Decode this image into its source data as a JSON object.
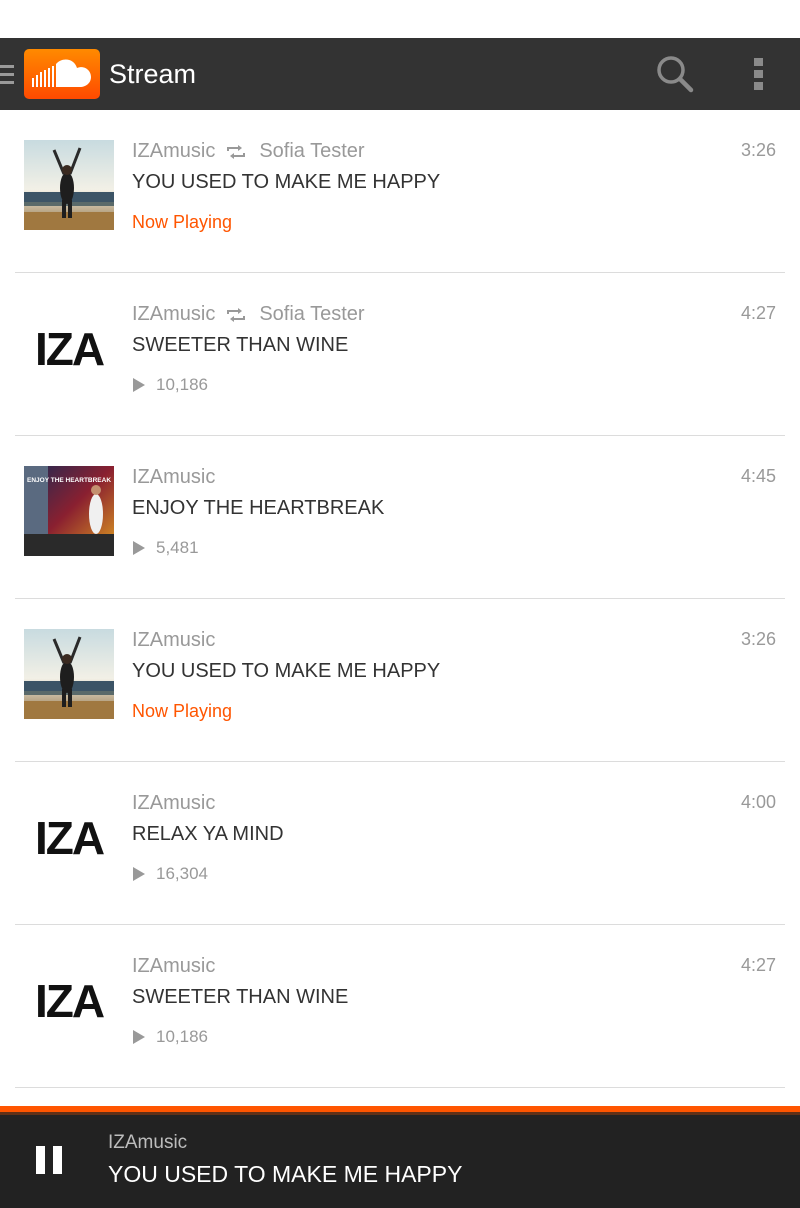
{
  "header": {
    "title": "Stream",
    "logo_icon": "soundcloud-logo",
    "search_icon": "search-icon",
    "menu_icon": "overflow-menu-icon",
    "accent_color": "#ff5500",
    "bar_color": "#333333"
  },
  "tracks": [
    {
      "artist": "IZAmusic",
      "reposted_by": "Sofia Tester",
      "title": "YOU USED TO MAKE ME HAPPY",
      "duration": "3:26",
      "status": "Now Playing",
      "plays": "",
      "artwork": "photo-arms-raised"
    },
    {
      "artist": "IZAmusic",
      "reposted_by": "Sofia Tester",
      "title": "SWEETER THAN WINE",
      "duration": "4:27",
      "status": "",
      "plays": "10,186",
      "artwork": "iza-logo"
    },
    {
      "artist": "IZAmusic",
      "reposted_by": "",
      "title": "ENJOY THE HEARTBREAK",
      "duration": "4:45",
      "status": "",
      "plays": "5,481",
      "artwork": "enjoy-the-heartbreak-cover"
    },
    {
      "artist": "IZAmusic",
      "reposted_by": "",
      "title": "YOU USED TO MAKE ME HAPPY",
      "duration": "3:26",
      "status": "Now Playing",
      "plays": "",
      "artwork": "photo-arms-raised"
    },
    {
      "artist": "IZAmusic",
      "reposted_by": "",
      "title": "RELAX YA MIND",
      "duration": "4:00",
      "status": "",
      "plays": "16,304",
      "artwork": "iza-logo"
    },
    {
      "artist": "IZAmusic",
      "reposted_by": "",
      "title": "SWEETER THAN WINE",
      "duration": "4:27",
      "status": "",
      "plays": "10,186",
      "artwork": "iza-logo"
    }
  ],
  "artwork_text": {
    "iza_logo": "IZA",
    "cover_text": "ENJOY THE HEARTBREAK"
  },
  "player": {
    "artist": "IZAmusic",
    "title": "YOU USED TO MAKE ME HAPPY",
    "state_icon": "pause-icon"
  }
}
